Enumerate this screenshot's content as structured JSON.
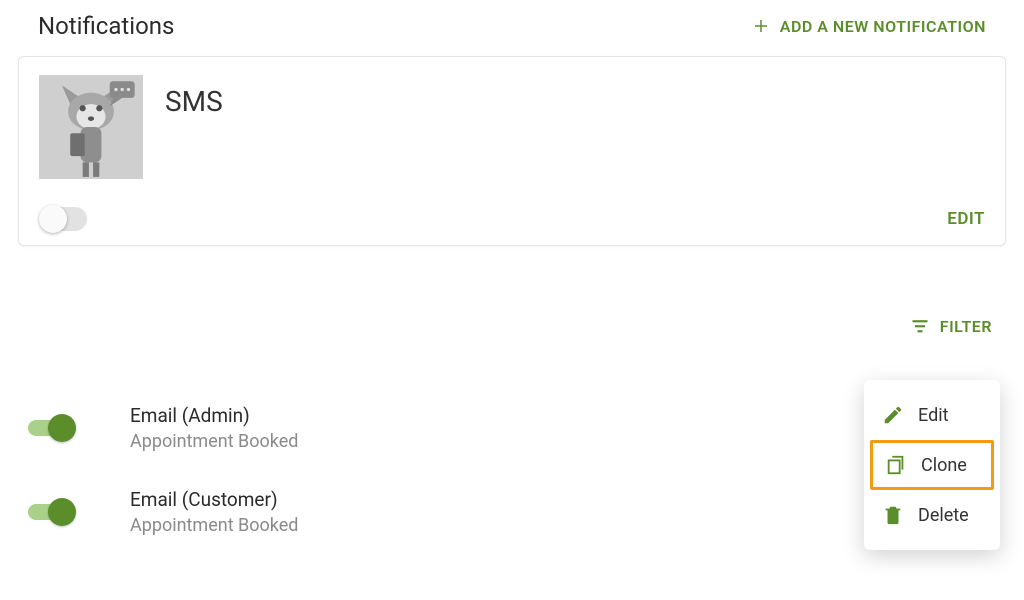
{
  "header": {
    "title": "Notifications",
    "add_label": "ADD A NEW NOTIFICATION"
  },
  "card": {
    "title": "SMS",
    "edit_label": "EDIT"
  },
  "filter": {
    "label": "FILTER"
  },
  "rows": [
    {
      "title": "Email (Admin)",
      "sub": "Appointment Booked"
    },
    {
      "title": "Email (Customer)",
      "sub": "Appointment Booked"
    }
  ],
  "menu": {
    "edit": "Edit",
    "clone": "Clone",
    "delete": "Delete"
  },
  "colors": {
    "accent": "#5b8e2b",
    "highlight": "#f39c12"
  }
}
